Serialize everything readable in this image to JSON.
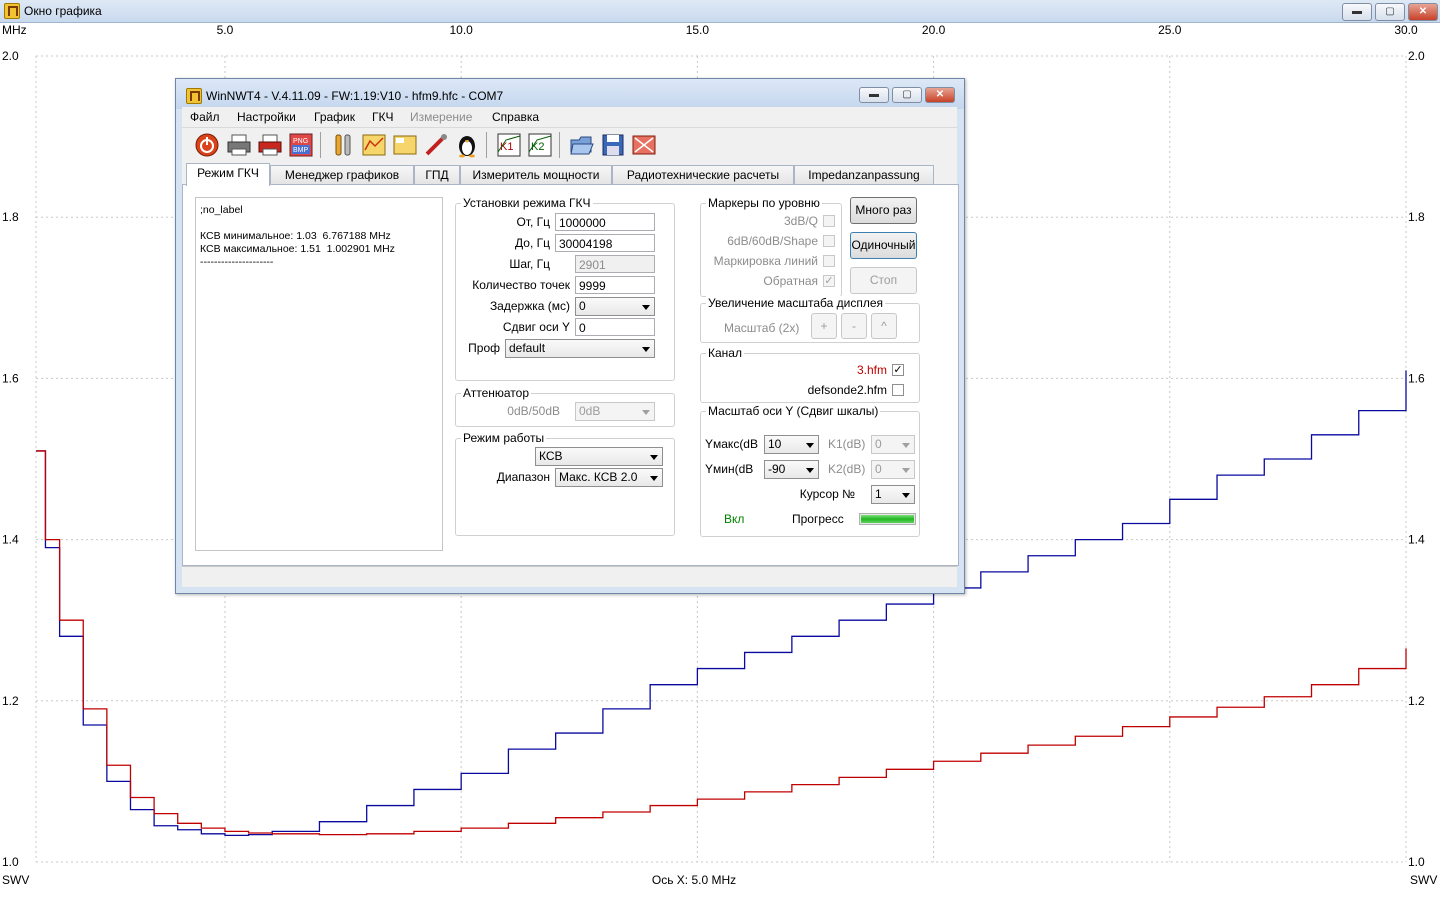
{
  "outer_window": {
    "title": "Окно графика",
    "min": "▬",
    "max": "▢",
    "close": "✕"
  },
  "chart": {
    "x_unit": "MHz",
    "x_ticks": [
      "5.0",
      "10.0",
      "15.0",
      "20.0",
      "25.0",
      "30.0"
    ],
    "y_ticks_left": [
      "2.0",
      "1.8",
      "1.6",
      "1.4",
      "1.2",
      "1.0"
    ],
    "y_ticks_right": [
      "2.0",
      "1.8",
      "1.6",
      "1.4",
      "1.2",
      "1.0"
    ],
    "y_unit_left": "SWV",
    "y_unit_right": "SWV",
    "x_axis_caption": "Ось X: 5.0 MHz",
    "colors": {
      "series1": "#0a0aa0",
      "series2": "#c00000",
      "grid": "#c8c8c8"
    }
  },
  "chart_data": {
    "type": "line",
    "xlabel": "Ось X: 5.0 MHz",
    "ylabel": "SWV",
    "x_unit": "MHz",
    "xlim": [
      1.0,
      30.0
    ],
    "ylim": [
      1.0,
      2.0
    ],
    "grid": true,
    "series": [
      {
        "color": "#0a0aa0",
        "x": [
          1.0,
          1.2,
          1.5,
          2.0,
          2.5,
          3.0,
          3.5,
          4.0,
          4.5,
          5.0,
          5.5,
          6.0,
          7.0,
          8.0,
          9.0,
          10.0,
          11.0,
          12.0,
          13.0,
          14.0,
          15.0,
          16.0,
          17.0,
          18.0,
          19.0,
          20.0,
          21.0,
          22.0,
          23.0,
          24.0,
          25.0,
          26.0,
          27.0,
          28.0,
          29.0,
          30.0
        ],
        "y": [
          1.51,
          1.39,
          1.28,
          1.17,
          1.1,
          1.065,
          1.045,
          1.04,
          1.035,
          1.033,
          1.034,
          1.038,
          1.05,
          1.07,
          1.09,
          1.11,
          1.14,
          1.16,
          1.19,
          1.22,
          1.24,
          1.26,
          1.28,
          1.3,
          1.32,
          1.34,
          1.36,
          1.38,
          1.4,
          1.42,
          1.45,
          1.48,
          1.5,
          1.53,
          1.56,
          1.61
        ]
      },
      {
        "color": "#c00000",
        "x": [
          1.0,
          1.2,
          1.5,
          2.0,
          2.5,
          3.0,
          3.5,
          4.0,
          4.5,
          5.0,
          5.5,
          6.0,
          7.0,
          8.0,
          9.0,
          10.0,
          11.0,
          12.0,
          13.0,
          14.0,
          15.0,
          16.0,
          17.0,
          18.0,
          19.0,
          20.0,
          21.0,
          22.0,
          23.0,
          24.0,
          25.0,
          26.0,
          27.0,
          28.0,
          29.0,
          30.0
        ],
        "y": [
          1.51,
          1.4,
          1.3,
          1.19,
          1.12,
          1.08,
          1.06,
          1.048,
          1.042,
          1.038,
          1.036,
          1.035,
          1.034,
          1.035,
          1.038,
          1.042,
          1.048,
          1.055,
          1.062,
          1.07,
          1.078,
          1.087,
          1.096,
          1.105,
          1.115,
          1.125,
          1.135,
          1.145,
          1.156,
          1.168,
          1.18,
          1.192,
          1.205,
          1.22,
          1.24,
          1.265
        ]
      }
    ]
  },
  "dialog": {
    "title": "WinNWT4 - V.4.11.09 - FW:1.19:V10 - hfm9.hfc - COM7",
    "menu": [
      "Файл",
      "Настройки",
      "График",
      "ГКЧ",
      "Измерение",
      "Справка"
    ],
    "toolbar_icons": [
      "power-icon",
      "printer-icon",
      "printer-color-icon",
      "png-bmp-icon",
      "tools-icon",
      "chart-icon",
      "db-icon",
      "wrench-icon",
      "penguin-icon",
      "k1-icon",
      "k2-icon",
      "open-folder-icon",
      "save-icon",
      "clear-icon"
    ],
    "tabs": [
      "Режим ГКЧ",
      "Менеджер графиков",
      "ГПД",
      "Измеритель мощности",
      "Радиотехнические расчеты",
      "Impedanzanpassung"
    ],
    "log": {
      "line1": ";no_label",
      "line2": "",
      "line3": "КСВ минимальное: 1.03  6.767188 MHz",
      "line4": "КСВ максимальное: 1.51  1.002901 MHz",
      "line5": "---------------------"
    },
    "sweep": {
      "title": "Установки режима ГКЧ",
      "from_label": "От, Гц",
      "from_value": "1000000",
      "to_label": "До, Гц",
      "to_value": "30004198",
      "step_label": "Шаг, Гц",
      "step_value": "2901",
      "points_label": "Количество точек",
      "points_value": "9999",
      "delay_label": "Задержка (мс)",
      "delay_value": "0",
      "yshift_label": "Сдвиг оси Y",
      "yshift_value": "0",
      "profile_label": "Проф",
      "profile_value": "default"
    },
    "attenuator": {
      "title": "Аттенюатор",
      "label": "0dB/50dB",
      "value": "0dB"
    },
    "mode": {
      "title": "Режим работы",
      "mode_value": "КСВ",
      "range_label": "Диапазон",
      "range_value": "Макс. КСВ 2.0"
    },
    "markers": {
      "title": "Маркеры по уровню",
      "m1": "3dB/Q",
      "m2": "6dB/60dB/Shape",
      "m3": "Маркировка линий",
      "m4": "Обратная"
    },
    "buttons": {
      "multi": "Много раз",
      "single": "Одиночный",
      "stop": "Стоп"
    },
    "zoom": {
      "title": "Увеличение масштаба дисплея",
      "label": "Масштаб (2х)",
      "plus": "+",
      "minus": "-",
      "caret": "^"
    },
    "channel": {
      "title": "Канал",
      "ch1": "3.hfm",
      "ch2": "defsonde2.hfm",
      "ch1_color": "#c00000"
    },
    "yscale": {
      "title": "Масштаб оси Y (Сдвиг шкалы)",
      "ymax_label": "Yмакс(dB",
      "ymax_value": "10",
      "ymin_label": "Yмин(dB",
      "ymin_value": "-90",
      "k1_label": "K1(dB)",
      "k1_value": "0",
      "k2_label": "K2(dB)",
      "k2_value": "0",
      "cursor_label": "Курсор №",
      "cursor_value": "1",
      "on_label": "Вкл",
      "on_color": "#008000",
      "progress_label": "Прогресс",
      "progress": 1.0
    }
  }
}
